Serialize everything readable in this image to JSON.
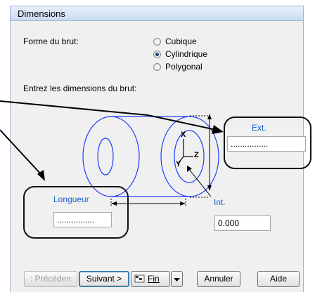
{
  "dialog": {
    "title": "Dimensions"
  },
  "shape": {
    "label": "Forme du brut:",
    "options": [
      {
        "label": "Cubique",
        "selected": false
      },
      {
        "label": "Cylindrique",
        "selected": true
      },
      {
        "label": "Polygonal",
        "selected": false
      }
    ]
  },
  "dimensions": {
    "label": "Entrez les dimensions du brut:",
    "ext": {
      "label": "Ext.",
      "value": "................"
    },
    "longueur": {
      "label": "Longueur",
      "value": "................"
    },
    "int": {
      "label": "Int.",
      "value": "0.000"
    }
  },
  "axes": {
    "x": "X",
    "y": "Y",
    "z": "Z"
  },
  "buttons": {
    "previous": ": Précéden",
    "next": "Suivant >",
    "finish": "Fin",
    "cancel": "Annuler",
    "help": "Aide"
  },
  "colors": {
    "accent": "#1a5fd0",
    "shape_stroke": "#1e3cff",
    "header": "#cadcf1"
  }
}
